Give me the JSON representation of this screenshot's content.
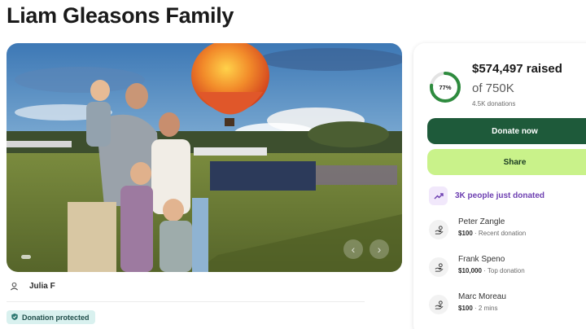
{
  "page": {
    "title": "Liam Gleasons Family"
  },
  "hero": {
    "image_alt": "Family photo in front of a hot air balloon"
  },
  "organizer": {
    "name": "Julia F",
    "icon": "person-icon"
  },
  "badge": {
    "label": "Donation protected",
    "icon": "shield-check-icon"
  },
  "progress": {
    "raised": "$574,497 raised",
    "goal": "of 750K",
    "donations": "4.5K donations",
    "percent_label": "77%",
    "percent": 0.77
  },
  "actions": {
    "donate_label": "Donate now",
    "share_label": "Share"
  },
  "trend": {
    "text": "3K people just donated",
    "icon": "trending-up-icon"
  },
  "donors": [
    {
      "name": "Peter Zangle",
      "amount": "$100",
      "detail": "Recent donation"
    },
    {
      "name": "Frank Speno",
      "amount": "$10,000",
      "detail": "Top donation"
    },
    {
      "name": "Marc Moreau",
      "amount": "$100",
      "detail": "2 mins"
    }
  ],
  "colors": {
    "donate_bg": "#1e5a3a",
    "share_bg": "#c9f28a",
    "ring": "#2e8b3e",
    "trend": "#6d3fb1",
    "badge_bg": "#d9f1ef"
  }
}
